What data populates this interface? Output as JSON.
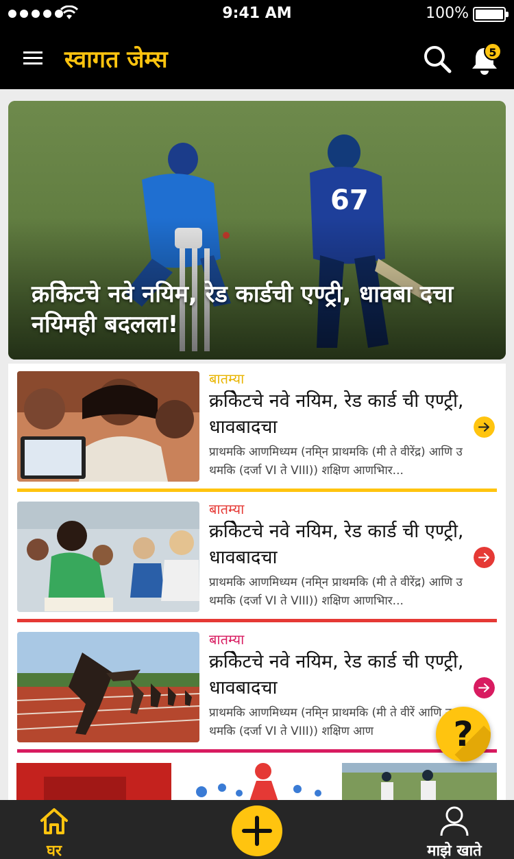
{
  "status_bar": {
    "time": "9:41 AM",
    "battery": "100%"
  },
  "header": {
    "title": "स्वागत जेम्स",
    "notification_count": "5"
  },
  "hero": {
    "title": "क्रकिेटचे नवे नयिम, रेड कार्डची एण्ट्री, धावबा दचा नयिमही बदलला!"
  },
  "articles": [
    {
      "category": "बातम्या",
      "category_color": "#e8b400",
      "headline": "क्रकिेटचे नवे नयिम, रेड कार्ड ची एण्ट्री, धावबादचा",
      "description": "प्राथमकि आणमिध्यम (नमि्न प्राथमकि (मी ते वीरेंद्र) आणि उ थमकि (दर्जा VI ते VIII)) शक्षिण आणभिार...",
      "accent_color": "#ffc40f",
      "arrow_icon": "arrow-right-icon"
    },
    {
      "category": "बातम्या",
      "category_color": "#e53935",
      "headline": "क्रकिेटचे नवे नयिम, रेड कार्ड ची एण्ट्री, धावबादचा",
      "description": "प्राथमकि आणमिध्यम (नमि्न प्राथमकि (मी ते वीरेंद्र) आणि उ थमकि (दर्जा VI ते VIII)) शक्षिण आणभिार...",
      "accent_color": "#e53935",
      "arrow_icon": "arrow-right-icon"
    },
    {
      "category": "बातम्या",
      "category_color": "#d81b60",
      "headline": "क्रकिेटचे नवे नयिम, रेड कार्ड ची एण्ट्री, धावबादचा",
      "description": "प्राथमकि आणमिध्यम (नमि्न प्राथमकि (मी ते वीरें आणि उ थमकि (दर्जा VI ते VIII)) शक्षिण आण",
      "accent_color": "#d81b60",
      "arrow_icon": "arrow-right-icon"
    }
  ],
  "help_button": {
    "label": "?"
  },
  "tab_bar": {
    "home_label": "घर",
    "account_label": "माझे खाते"
  },
  "colors": {
    "brand_yellow": "#ffc40f",
    "header_bg": "#000000",
    "tabbar_bg": "#262626"
  }
}
